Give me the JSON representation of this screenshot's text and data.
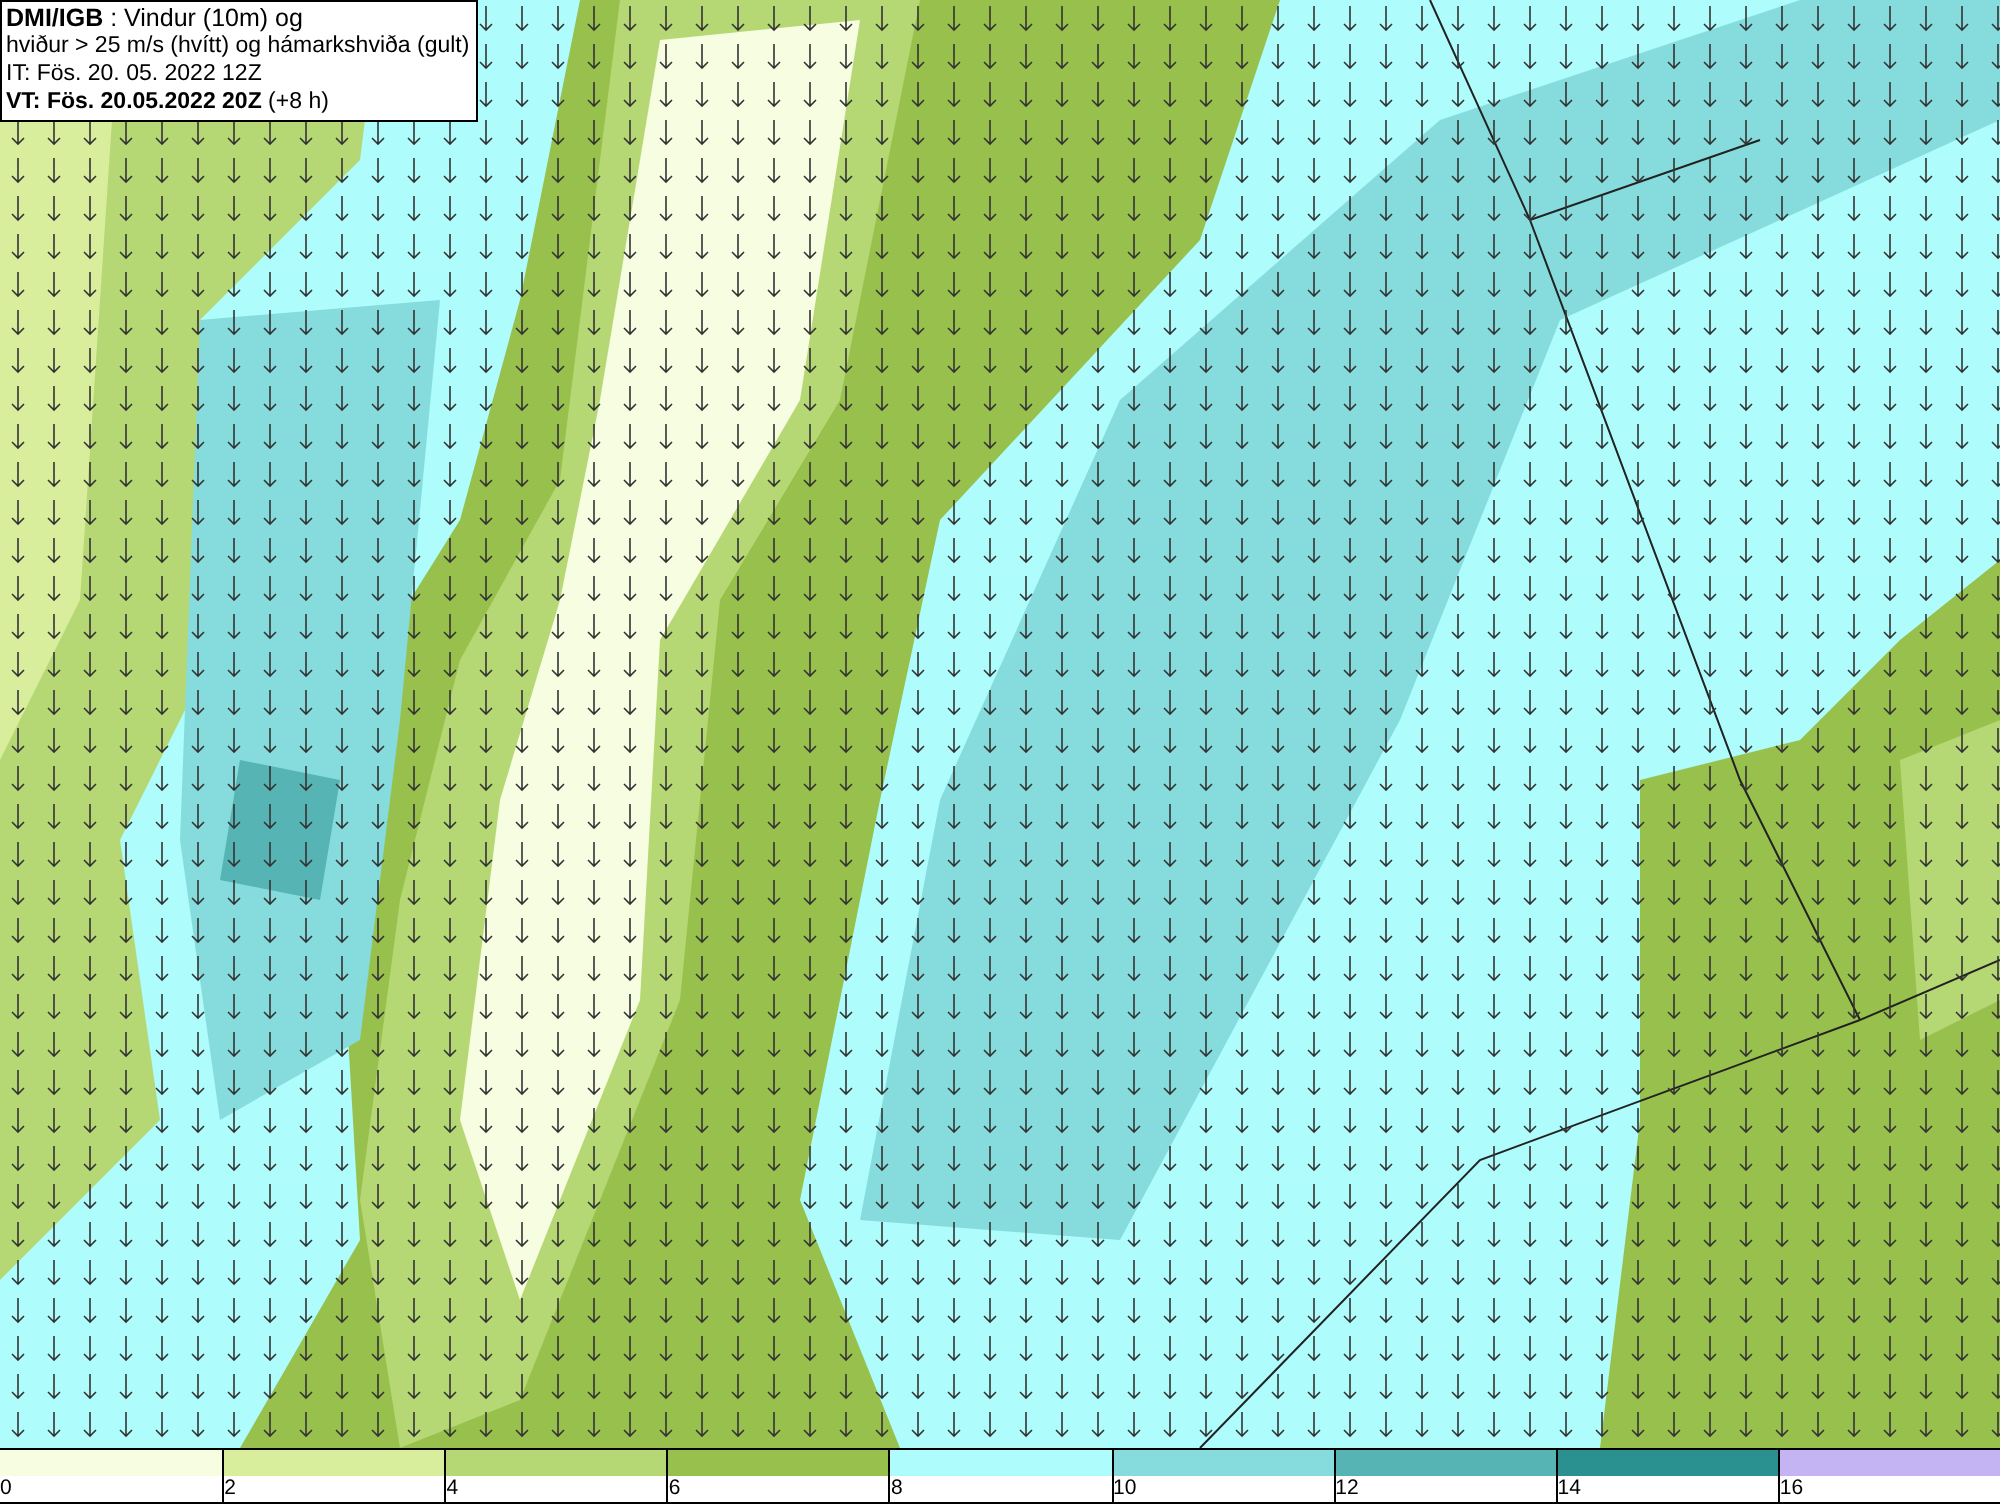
{
  "header": {
    "lines": [
      "**DMI/IGB** : Vindur (10m) og",
      "hviður > 25 m/s (hvítt) og hámarkshviða (gult)",
      "IT: Fös. 20. 05. 2022 12Z",
      "**VT: Fös. 20.05.2022 20Z** (+8 h)"
    ]
  },
  "legend": [
    {
      "label": "0",
      "color": "#f7fde0"
    },
    {
      "label": "2",
      "color": "#d8ee9c"
    },
    {
      "label": "4",
      "color": "#b6d874"
    },
    {
      "label": "6",
      "color": "#98c04c"
    },
    {
      "label": "8",
      "color": "#aefcfc"
    },
    {
      "label": "10",
      "color": "#86dcdc"
    },
    {
      "label": "12",
      "color": "#56b4b4"
    },
    {
      "label": "14",
      "color": "#2a9090"
    },
    {
      "label": "16",
      "color": "#c4b4f4"
    }
  ]
}
